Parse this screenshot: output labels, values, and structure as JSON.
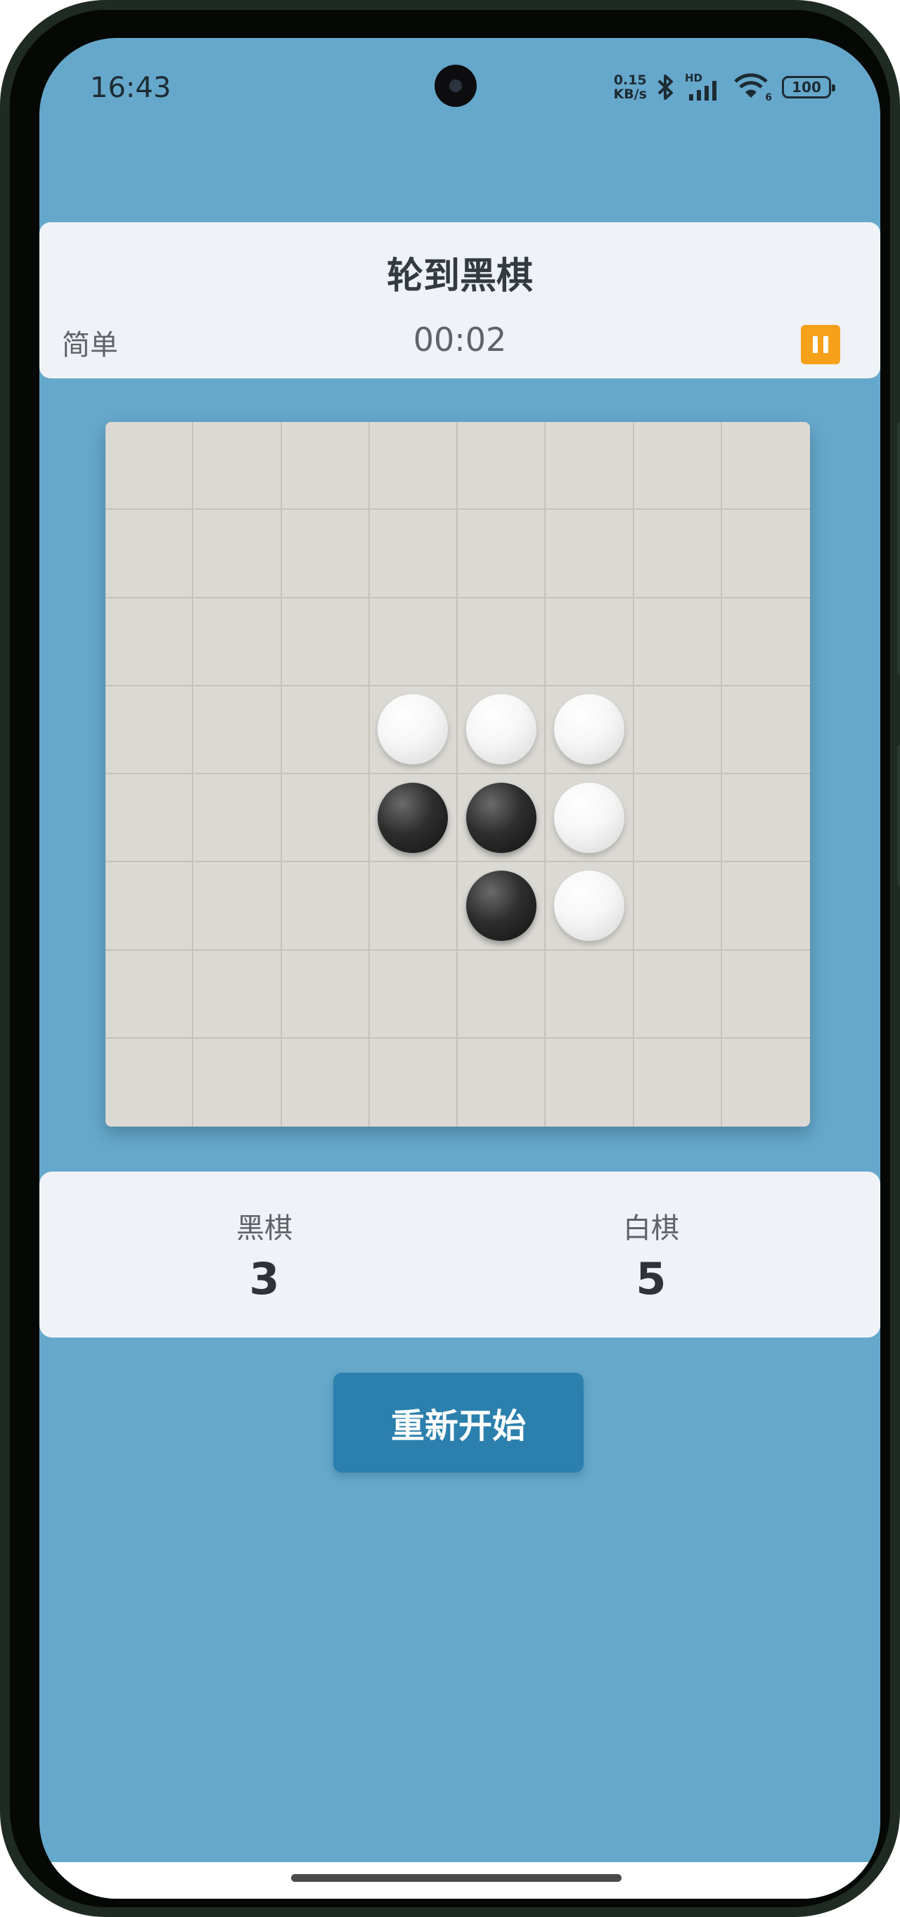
{
  "status_bar": {
    "time": "16:43",
    "net_speed_value": "0.15",
    "net_speed_unit": "KB/s",
    "network_label": "HD",
    "wifi_label": "6",
    "battery": "100"
  },
  "header": {
    "turn_text": "轮到黑棋",
    "difficulty": "简单",
    "timer": "00:02"
  },
  "board": {
    "size": 8,
    "pieces": [
      {
        "row": 3,
        "col": 3,
        "color": "white"
      },
      {
        "row": 3,
        "col": 4,
        "color": "white"
      },
      {
        "row": 3,
        "col": 5,
        "color": "white"
      },
      {
        "row": 4,
        "col": 3,
        "color": "black"
      },
      {
        "row": 4,
        "col": 4,
        "color": "black"
      },
      {
        "row": 4,
        "col": 5,
        "color": "white"
      },
      {
        "row": 5,
        "col": 4,
        "color": "black"
      },
      {
        "row": 5,
        "col": 5,
        "color": "white"
      }
    ]
  },
  "score": {
    "black_label": "黑棋",
    "black_count": "3",
    "white_label": "白棋",
    "white_count": "5"
  },
  "controls": {
    "restart_label": "重新开始"
  },
  "colors": {
    "background": "#66a8cb",
    "card": "#eff3f8",
    "accent_button": "#2b80ad",
    "pause_button": "#f7a11a",
    "board": "#dbd9d4"
  }
}
